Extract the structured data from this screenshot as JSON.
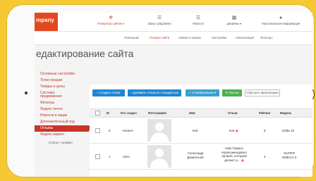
{
  "app": {
    "logo_text": "mpany"
  },
  "topnav": [
    {
      "label": "Генератор сайтов",
      "icon": "gears-icon",
      "active": true
    },
    {
      "label": "Заказ субдомена",
      "icon": "list-icon",
      "active": false
    },
    {
      "label": "Новости",
      "icon": "list-icon",
      "active": false
    },
    {
      "label": "Дизайны",
      "icon": "grid-icon",
      "active": false
    },
    {
      "label": "Персональная информация",
      "icon": "user-icon",
      "active": false
    }
  ],
  "subnav": [
    {
      "label": "Помощник",
      "active": false
    },
    {
      "label": "Отзывы сайта",
      "active": true
    },
    {
      "label": "Заявки и заказы",
      "active": false
    },
    {
      "label": "Настройки",
      "active": false
    },
    {
      "label": "Локализация",
      "active": false
    },
    {
      "label": "Фильтры",
      "active": false
    }
  ],
  "page_title": "едактирование сайта",
  "sidebar": {
    "items": [
      {
        "label": "Основные настройки",
        "active": false
      },
      {
        "label": "Точки продаж",
        "active": false
      },
      {
        "label": "Товары и цены",
        "active": false
      },
      {
        "label": "Система",
        "active": false
      },
      {
        "label": "продвижения",
        "active": false
      },
      {
        "label": "Фильтры",
        "active": false
      },
      {
        "label": "Яндекс лента",
        "active": false
      },
      {
        "label": "Новости и акции",
        "active": false
      },
      {
        "label": "Дополнительный код",
        "active": false
      },
      {
        "label": "Отзывы",
        "active": true
      },
      {
        "label": "Яндекс маркет",
        "active": false
      }
    ],
    "footer": "Статус: Активен"
  },
  "toolbar": {
    "create": "Создать отзыв",
    "add_standard": "Добавить отзыв из стандартных",
    "with_selected": "С выбранными",
    "filter": "Фильтр",
    "reset_filter": "Сбросить фильтрацию"
  },
  "table": {
    "headers": [
      "ID",
      "Кто создал",
      "Фотография",
      "Имя",
      "Отзыв",
      "Рейтинг",
      "Модель"
    ],
    "rows": [
      {
        "id": "5",
        "creator": "Клиент",
        "name": "test",
        "review": "test",
        "rating": "5",
        "model": "Delta 10"
      },
      {
        "id": "1",
        "creator": "Авто",
        "name": "Александр Дементьев",
        "review": "Нам Тормос порекомендовал прораб, который делает р...",
        "rating": "4",
        "model": "SUPER OMEGA 3"
      }
    ]
  },
  "colors": {
    "accent": "#c0392b",
    "primary_button": "#1f86d1",
    "filter_button": "#4caf50",
    "background": "#f6c932"
  }
}
